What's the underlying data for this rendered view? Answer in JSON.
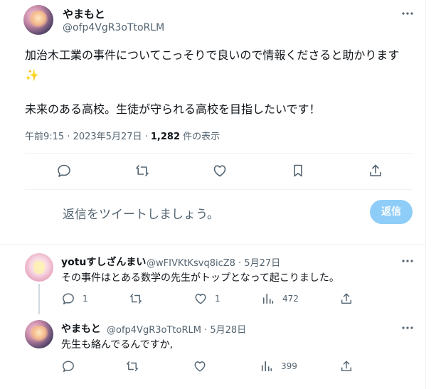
{
  "main_tweet": {
    "display_name": "やまもと",
    "handle": "@ofp4VgR3oTtoRLM",
    "line1": "加治木工業の事件についてこっそりで良いので情報くださると助かります",
    "line2": "✨",
    "line3": "未来のある高校。生徒が守られる高校を目指したいです！",
    "time": "午前9:15 · 2023年5月27日 · ",
    "views": "1,282",
    "views_suffix": " 件の表示"
  },
  "reply_box": {
    "placeholder": "返信をツイートしましょう。",
    "button_label": "返信"
  },
  "reply1": {
    "display_name": "yotuすしざんまい",
    "handle": "@wFIVKtKsvq8icZ8 · 5月27日",
    "text": "その事件はとある数学の先生がトップとなって起こりました。",
    "reply_count": "1",
    "retweet_count": "",
    "like_count": "1",
    "view_count": "472"
  },
  "reply2": {
    "display_name": "やまもと",
    "handle": "@ofp4VgR3oTtoRLM · 5月28日",
    "text": "先生も絡んでるんですか,",
    "view_count": "399"
  },
  "icons": [
    "more-icon",
    "reply-icon",
    "retweet-icon",
    "like-icon",
    "bookmark-icon",
    "share-icon",
    "views-icon"
  ]
}
